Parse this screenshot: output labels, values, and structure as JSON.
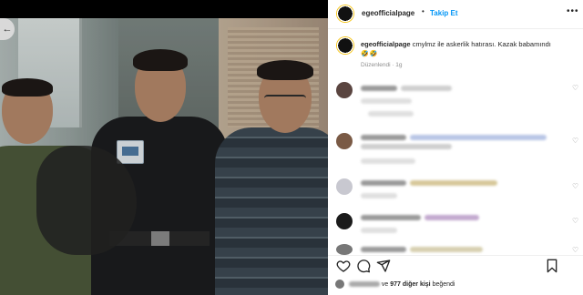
{
  "post": {
    "username": "egeofficialpage",
    "dot": "•",
    "follow_label": "Takip Et",
    "more_label": "•••",
    "caption_user": "egeofficialpage",
    "caption_text": "cmylmz ile askerlik hatırası. Kazak babamındı",
    "caption_emoji": "🤣🤣",
    "edited_label": "Düzenlendi · 1g"
  },
  "photo": {
    "back_label": "←"
  },
  "comments": [
    {
      "heart": "♡"
    },
    {
      "heart": "♡"
    },
    {
      "heart": "♡"
    },
    {
      "heart": "♡"
    },
    {
      "heart": "♡"
    }
  ],
  "actions": {
    "like_icon": "heart-icon",
    "comment_icon": "comment-icon",
    "share_icon": "share-icon",
    "save_icon": "bookmark-icon"
  },
  "likes": {
    "separator": "ve",
    "count_text": "977 diğer kişi",
    "suffix": "beğendi"
  },
  "colors": {
    "accent": "#0095f6",
    "text": "#262626",
    "muted": "#8e8e8e"
  }
}
